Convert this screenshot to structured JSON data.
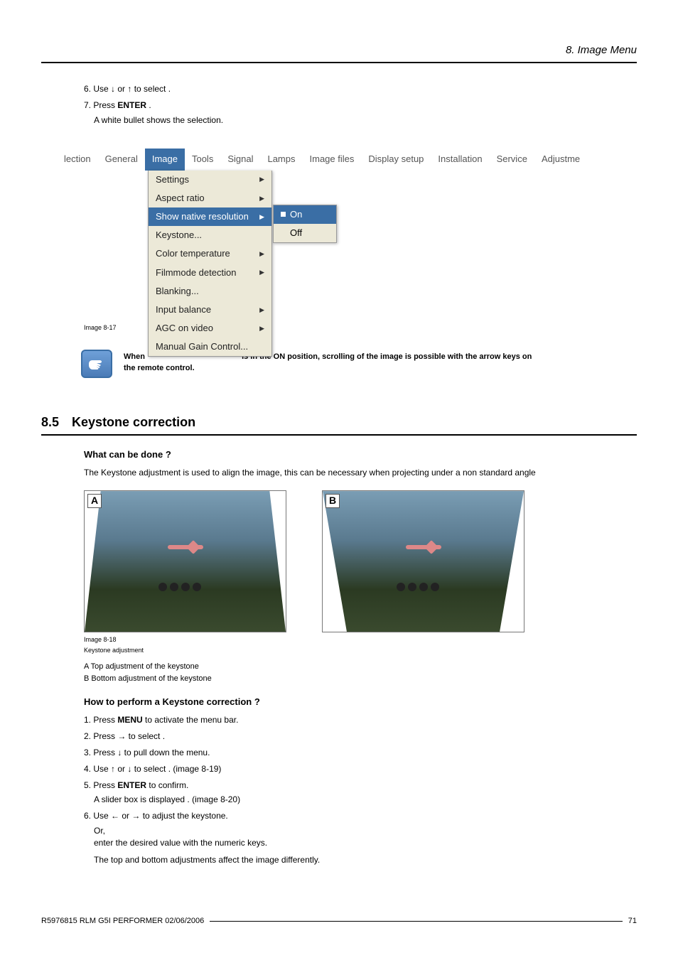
{
  "header": {
    "title": "8. Image Menu"
  },
  "steps_top": {
    "s6_prefix": "6. Use ↓ or ↑ to select ",
    "s6_suffix": ".",
    "s7_prefix": "7. Press ",
    "s7_bold": "ENTER",
    "s7_suffix": " .",
    "s7_sub": "A white bullet shows the selection."
  },
  "menubar": {
    "items": [
      "lection",
      "General",
      "Image",
      "Tools",
      "Signal",
      "Lamps",
      "Image files",
      "Display setup",
      "Installation",
      "Service",
      "Adjustme"
    ],
    "active_index": 2
  },
  "dropdown": {
    "items": [
      {
        "label": "Settings",
        "arrow": true
      },
      {
        "label": "Aspect ratio",
        "arrow": true
      },
      {
        "label": "Show native resolution",
        "arrow": true,
        "highlight": true
      },
      {
        "label": "Keystone...",
        "arrow": false
      },
      {
        "label": "Color temperature",
        "arrow": true
      },
      {
        "label": "Filmmode detection",
        "arrow": true
      },
      {
        "label": "Blanking...",
        "arrow": false
      },
      {
        "label": "Input balance",
        "arrow": true
      },
      {
        "label": "AGC on video",
        "arrow": true
      },
      {
        "label": "Manual Gain Control...",
        "arrow": false
      }
    ]
  },
  "submenu": {
    "items": [
      {
        "label": "On",
        "highlight": true,
        "bullet": true
      },
      {
        "label": "Off",
        "highlight": false,
        "bullet": false
      }
    ]
  },
  "img_caption_1": "Image 8-17",
  "note": {
    "line1_a": "When ",
    "line1_b": " is in the ON position, scrolling of the image is possible with the arrow keys on",
    "line2": "the remote control."
  },
  "section85": {
    "num": "8.5",
    "title": "Keystone correction"
  },
  "keystone": {
    "sub1": "What can be done ?",
    "para1": "The Keystone adjustment is used to align the image, this can be necessary when projecting under a non standard angle"
  },
  "image_labels": {
    "A": "A",
    "B": "B"
  },
  "img_caption_2a": "Image 8-18",
  "img_caption_2b": "Keystone adjustment",
  "legend": {
    "A": "A    Top adjustment of the keystone",
    "B": "B    Bottom adjustment of the keystone"
  },
  "howto": {
    "title": "How to perform a Keystone correction ?",
    "s1_a": "1. Press ",
    "s1_b": "MENU",
    "s1_c": " to activate the menu bar.",
    "s2": "2. Press → to select            .",
    "s3": "3. Press ↓ to pull down the             menu.",
    "s4": "4. Use ↑ or ↓ to select                . (image 8-19)",
    "s5_a": "5. Press ",
    "s5_b": "ENTER",
    "s5_c": " to confirm.",
    "s5_sub": "A slider box is displayed .  (image 8-20)",
    "s6": "6. Use ← or → to adjust the keystone.",
    "s6_or": "Or,",
    "s6_sub1": "enter the desired value with the numeric keys.",
    "s6_sub2": "The top and bottom adjustments affect the image differently."
  },
  "footer": {
    "left": "R5976815  RLM G5I PERFORMER  02/06/2006",
    "right": "71"
  }
}
